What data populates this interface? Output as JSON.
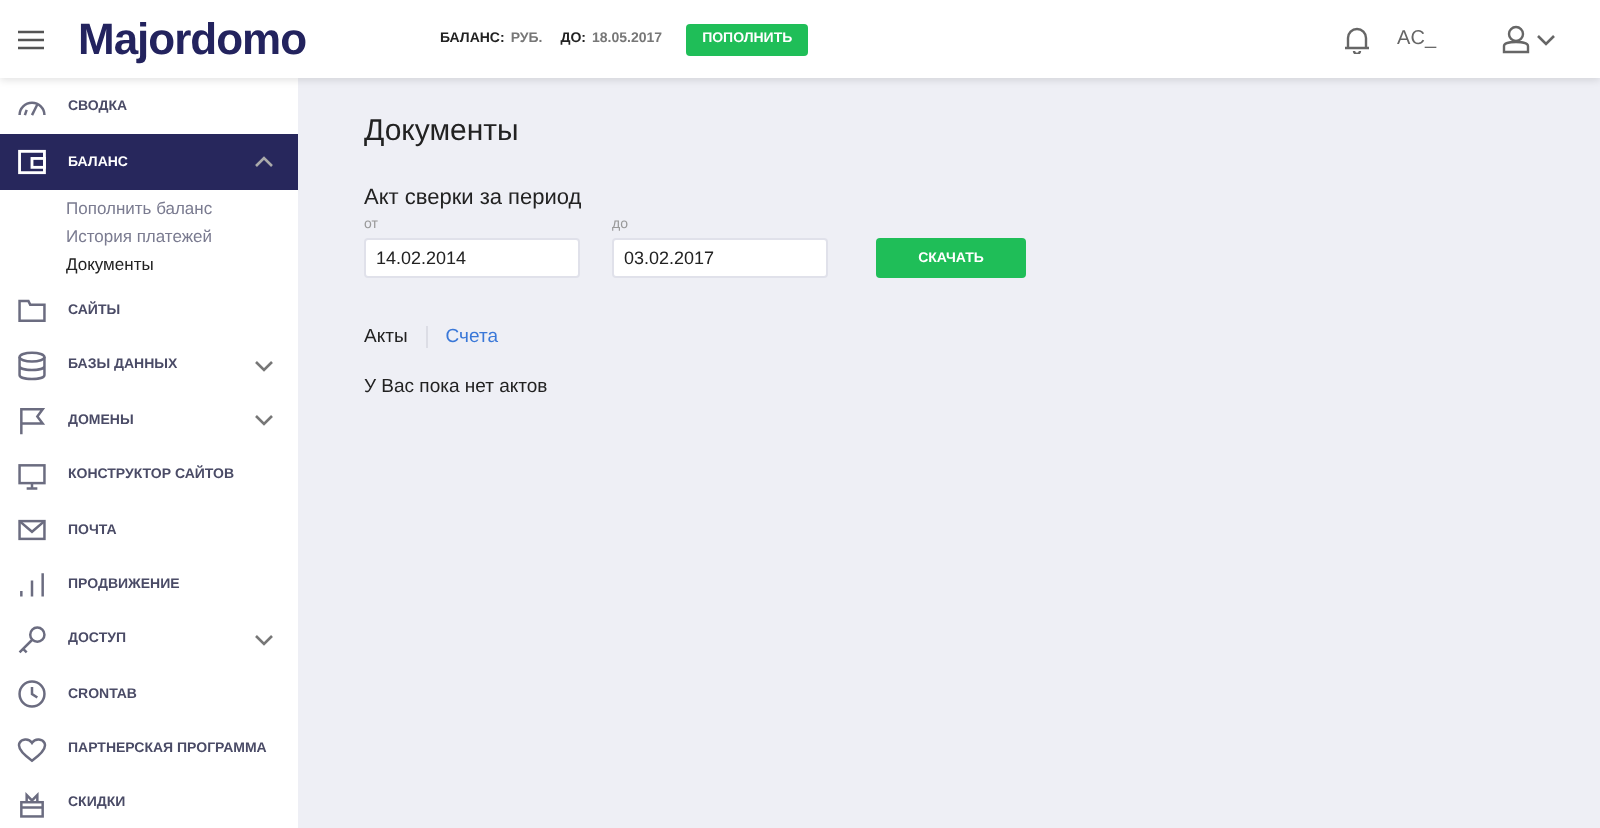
{
  "header": {
    "logo": "Majordomo",
    "balance_label": "БАЛАНС:",
    "balance_value": "РУБ.",
    "due_label": "ДО:",
    "due_value": "18.05.2017",
    "topup_button": "ПОПОЛНИТЬ",
    "account": "AC_"
  },
  "sidebar": {
    "items": [
      {
        "label": "СВОДКА",
        "selected": false
      },
      {
        "label": "БАЛАНС",
        "selected": true,
        "expanded": true,
        "children": [
          {
            "label": "Пополнить баланс",
            "selected": false
          },
          {
            "label": "История платежей",
            "selected": false
          },
          {
            "label": "Документы",
            "selected": true
          }
        ]
      },
      {
        "label": "САЙТЫ",
        "selected": false
      },
      {
        "label": "БАЗЫ ДАННЫХ",
        "selected": false,
        "expanded": false
      },
      {
        "label": "ДОМЕНЫ",
        "selected": false,
        "expanded": false
      },
      {
        "label": "КОНСТРУКТОР САЙТОВ",
        "selected": false
      },
      {
        "label": "ПОЧТА",
        "selected": false
      },
      {
        "label": "ПРОДВИЖЕНИЕ",
        "selected": false
      },
      {
        "label": "ДОСТУП",
        "selected": false,
        "expanded": false
      },
      {
        "label": "CRONTAB",
        "selected": false
      },
      {
        "label": "ПАРТНЕРСКАЯ ПРОГРАММА",
        "selected": false
      },
      {
        "label": "СКИДКИ",
        "selected": false
      }
    ]
  },
  "main": {
    "title": "Документы",
    "section_title": "Акт сверки за период",
    "from": {
      "label": "от",
      "value": "14.02.2014"
    },
    "to": {
      "label": "до",
      "value": "03.02.2017"
    },
    "download_button": "СКАЧАТЬ",
    "tabs": [
      {
        "label": "Акты",
        "selected": true
      },
      {
        "label": "Счета",
        "selected": false
      }
    ],
    "empty_message": "У Вас пока нет актов"
  }
}
